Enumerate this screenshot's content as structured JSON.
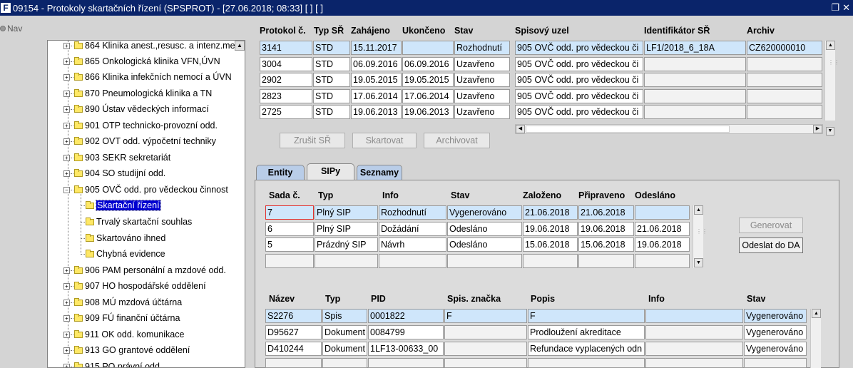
{
  "window": {
    "title": "09154 - Protokoly skartačních řízení (SPSPROT) - [27.06.2018; 08:33]  [ ]  [ ]",
    "app_icon_label": "F"
  },
  "nav": {
    "label": "Nav"
  },
  "tree": {
    "items": [
      {
        "label": "864 Klinika anest.,resusc. a intenz.me"
      },
      {
        "label": "865 Onkologická klinika VFN,ÚVN"
      },
      {
        "label": "866 Klinika infekčních nemocí a ÚVN"
      },
      {
        "label": "870 Pneumologická klinika a TN"
      },
      {
        "label": "890 Ústav vědeckých informací"
      },
      {
        "label": "901 OTP technicko-provozní odd."
      },
      {
        "label": "902 OVT odd. výpočetní techniky"
      },
      {
        "label": "903 SEKR sekretariát"
      },
      {
        "label": "904 SO studijní odd."
      },
      {
        "label": "905 OVČ odd. pro vědeckou činnost"
      },
      {
        "label": "Skartační řízení"
      },
      {
        "label": "Trvalý skartační souhlas"
      },
      {
        "label": "Skartováno ihned"
      },
      {
        "label": "Chybná evidence"
      },
      {
        "label": "906 PAM personální a mzdové odd."
      },
      {
        "label": "907 HO hospodářské oddělení"
      },
      {
        "label": "908 MÚ mzdová účtárna"
      },
      {
        "label": "909 FÚ finanční účtárna"
      },
      {
        "label": "911 OK odd. komunikace"
      },
      {
        "label": "913 GO grantové oddělení"
      },
      {
        "label": "915 PO právní odd."
      }
    ]
  },
  "protocols": {
    "headers": [
      "Protokol č.",
      "Typ SŘ",
      "Zahájeno",
      "Ukončeno",
      "Stav",
      "Spisový uzel",
      "Identifikátor SŘ",
      "Archiv"
    ],
    "rows": [
      [
        "3141",
        "STD",
        "15.11.2017",
        "",
        "Rozhodnutí",
        "905 OVČ odd. pro vědeckou či",
        "LF1/2018_6_18A",
        "CZ620000010"
      ],
      [
        "3004",
        "STD",
        "06.09.2016",
        "06.09.2016",
        "Uzavřeno",
        "905 OVČ odd. pro vědeckou či",
        "",
        ""
      ],
      [
        "2902",
        "STD",
        "19.05.2015",
        "19.05.2015",
        "Uzavřeno",
        "905 OVČ odd. pro vědeckou či",
        "",
        ""
      ],
      [
        "2823",
        "STD",
        "17.06.2014",
        "17.06.2014",
        "Uzavřeno",
        "905 OVČ odd. pro vědeckou či",
        "",
        ""
      ],
      [
        "2725",
        "STD",
        "19.06.2013",
        "19.06.2013",
        "Uzavřeno",
        "905 OVČ odd. pro vědeckou či",
        "",
        ""
      ]
    ],
    "buttons": {
      "cancel": "Zrušit SŘ",
      "shred": "Skartovat",
      "archive": "Archivovat"
    }
  },
  "tabs": [
    {
      "label": "Entity"
    },
    {
      "label": "SIPy"
    },
    {
      "label": "Seznamy"
    }
  ],
  "sips": {
    "headers": [
      "Sada č.",
      "Typ",
      "Info",
      "Stav",
      "Založeno",
      "Připraveno",
      "Odesláno"
    ],
    "rows": [
      [
        "7",
        "Plný SIP",
        "Rozhodnutí",
        "Vygenerováno",
        "21.06.2018",
        "21.06.2018",
        ""
      ],
      [
        "6",
        "Plný SIP",
        "Dožádání",
        "Odesláno",
        "19.06.2018",
        "19.06.2018",
        "21.06.2018"
      ],
      [
        "5",
        "Prázdný SIP",
        "Návrh",
        "Odesláno",
        "15.06.2018",
        "15.06.2018",
        "19.06.2018"
      ]
    ],
    "buttons": {
      "generate": "Generovat",
      "send": "Odeslat do DA"
    }
  },
  "items": {
    "headers": [
      "Název",
      "Typ",
      "PID",
      "Spis. značka",
      "Popis",
      "Info",
      "Stav"
    ],
    "rows": [
      [
        "S2276",
        "Spis",
        "0001822",
        "F",
        "F",
        "",
        "Vygenerováno"
      ],
      [
        "D95627",
        "Dokument",
        "0084799",
        "",
        "Prodloužení akreditace",
        "",
        "Vygenerováno"
      ],
      [
        "D410244",
        "Dokument",
        "1LF13-00633_00",
        "",
        "Refundace vyplacených odn",
        "",
        "Vygenerováno"
      ]
    ]
  },
  "colors": {
    "titlebar": "#0a246a",
    "selected_row": "#cfe6fb",
    "tree_selection": "#0000d0",
    "tab_blue": "#b9cde8"
  }
}
